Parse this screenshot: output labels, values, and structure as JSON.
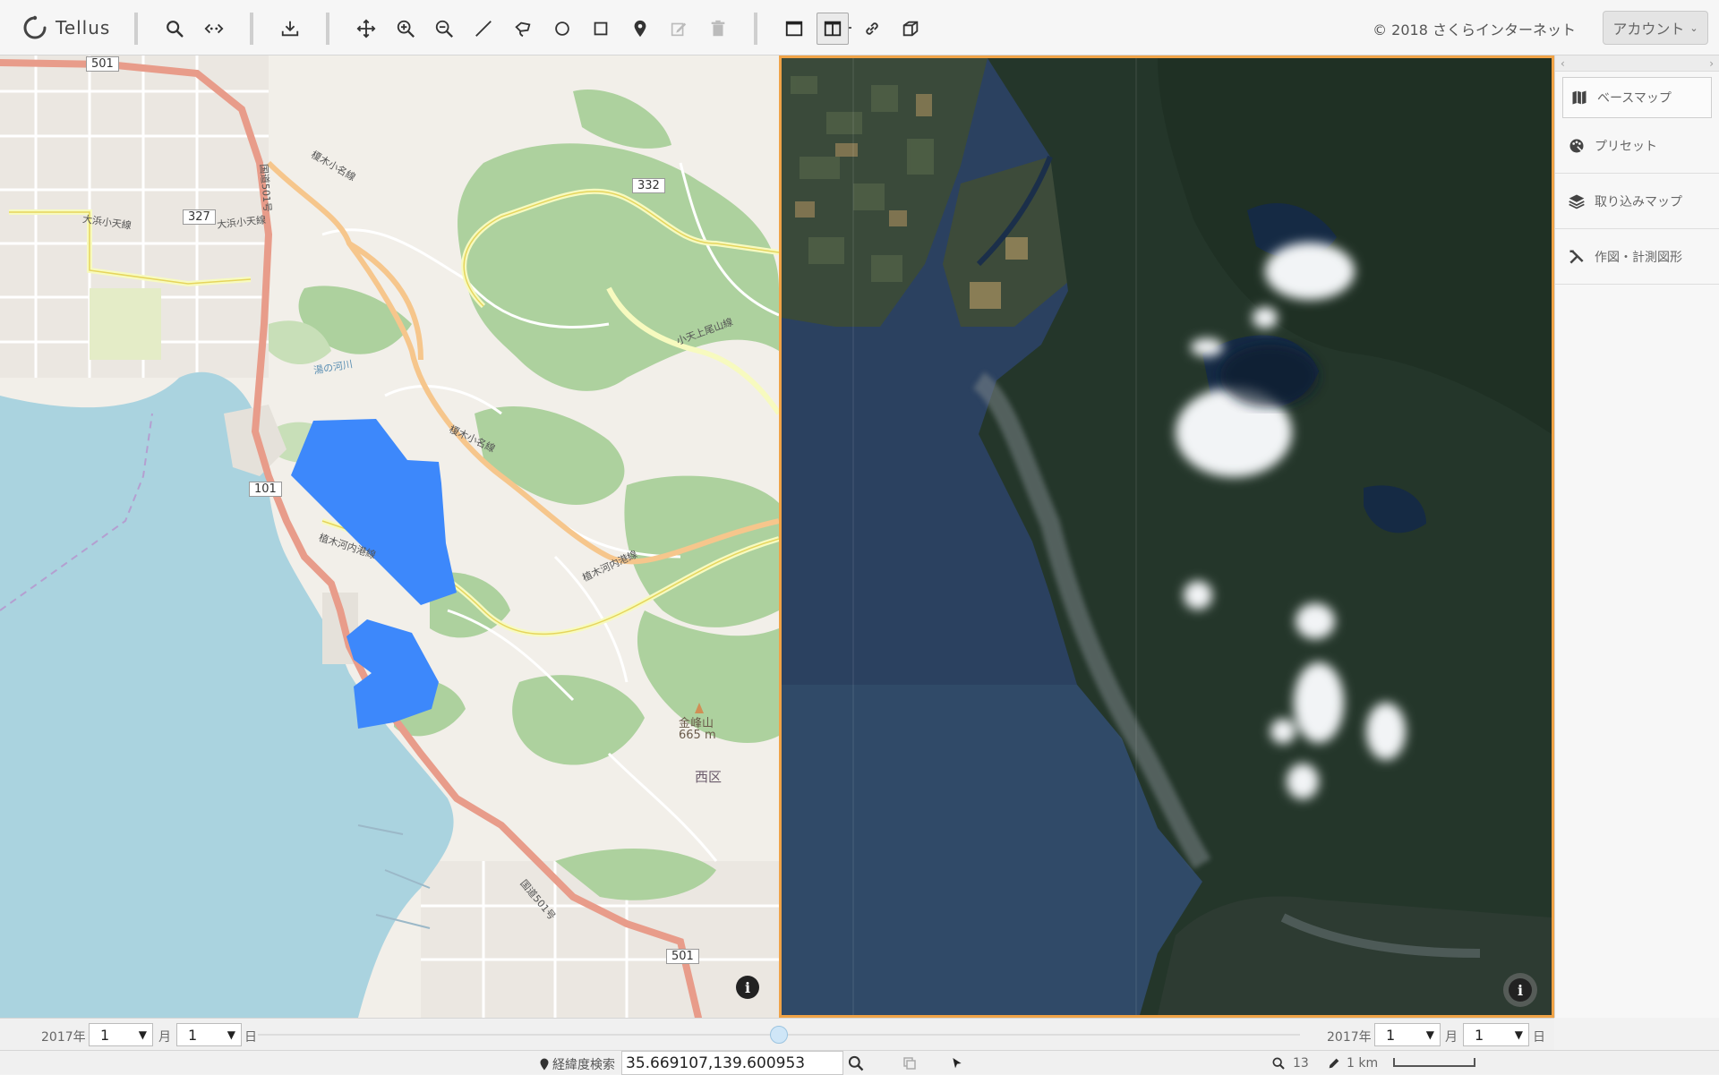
{
  "app": {
    "logo_text": "Tellus",
    "copyright": "© 2018 さくらインターネット",
    "account_label": "アカウント"
  },
  "toolbar": {
    "tools": [
      "search",
      "share-link",
      "download",
      "pan",
      "zoom-in",
      "zoom-out",
      "draw-line",
      "draw-lasso",
      "draw-circle",
      "draw-rectangle",
      "place-marker",
      "edit-shape",
      "delete-shape",
      "single-view",
      "split-view",
      "link-maps",
      "3d-view"
    ]
  },
  "left_map": {
    "labels": {
      "route_501_top": "501",
      "route_327": "327",
      "route_332": "332",
      "route_101": "101",
      "route_501_bottom": "501",
      "road_ohama": "大浜小天線",
      "road_ohama2": "大浜小天線",
      "road_enoki": "榎木小名線",
      "road_enoki2": "榎木小名線",
      "road_kokudo": "国道501号",
      "road_kokudo2": "国道501号",
      "road_minato": "植木河内港線",
      "road_minato2": "植木河内港線",
      "road_kawachi": "小天上尾山線",
      "river": "湯の河川",
      "mountain_name": "金峰山",
      "mountain_height": "665 m",
      "ward": "西区"
    }
  },
  "right_map": {},
  "side_panel": {
    "items": [
      {
        "label": "ベースマップ",
        "icon": "map-icon"
      },
      {
        "label": "プリセット",
        "icon": "palette-icon"
      },
      {
        "label": "取り込みマップ",
        "icon": "layers-icon"
      },
      {
        "label": "作図・計測図形",
        "icon": "drawing-tools-icon"
      }
    ]
  },
  "timeline": {
    "left": {
      "year": "2017年",
      "month_value": "1",
      "month_unit": "月",
      "day_value": "1",
      "day_unit": "日"
    },
    "right": {
      "year": "2017年",
      "month_value": "1",
      "month_unit": "月",
      "day_value": "1",
      "day_unit": "日"
    },
    "slider_position": 0.5
  },
  "statusbar": {
    "coord_label": "経緯度検索",
    "coord_value": "35.669107,139.600953",
    "zoom_level": "13",
    "scale": "1 km"
  }
}
